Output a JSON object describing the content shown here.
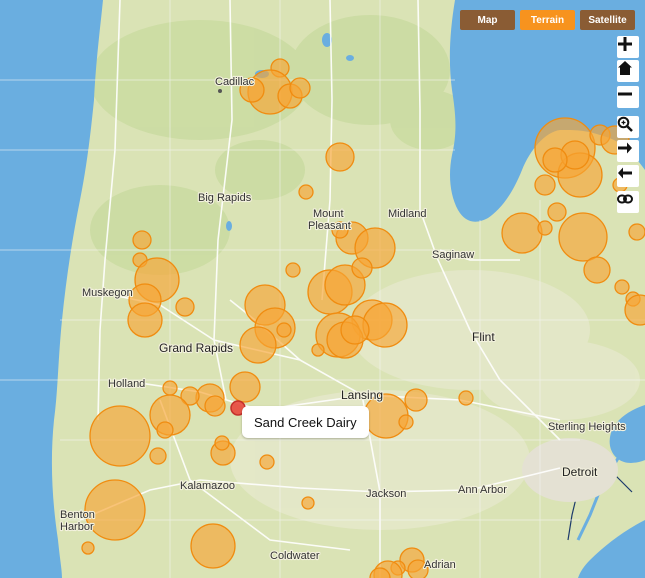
{
  "map_modes": {
    "map_label": "Map",
    "terrain_label": "Terrain",
    "satellite_label": "Satellite",
    "active": "Terrain"
  },
  "controls": {
    "zoom_in": "plus-icon",
    "home": "home-icon",
    "zoom_out": "minus-icon",
    "zoom_search": "magnifier-icon",
    "forward": "arrow-right-icon",
    "back": "arrow-left-icon",
    "link": "link-icon"
  },
  "cities": {
    "cadillac": "Cadillac",
    "big_rapids": "Big Rapids",
    "mount": "Mount",
    "pleasant": "Pleasant",
    "midland": "Midland",
    "saginaw": "Saginaw",
    "muskegon": "Muskegon",
    "grand_rapids": "Grand Rapids",
    "flint": "Flint",
    "holland": "Holland",
    "lansing": "Lansing",
    "sterling_heights": "Sterling Heights",
    "detroit": "Detroit",
    "kalamazoo": "Kalamazoo",
    "jackson": "Jackson",
    "ann_arbor": "Ann Arbor",
    "benton": "Benton",
    "harbor": "Harbor",
    "coldwater": "Coldwater",
    "adrian": "Adrian"
  },
  "tooltip": {
    "label": "Sand Creek Dairy"
  },
  "colors": {
    "water": "#6aaee0",
    "land": "#d9e3b6",
    "marker_fill": "#f7a534",
    "marker_stroke": "#f08c10",
    "selected_marker": "#e8473d",
    "toggle_active": "#f7931e",
    "toggle_inactive": "#8a5c34"
  }
}
